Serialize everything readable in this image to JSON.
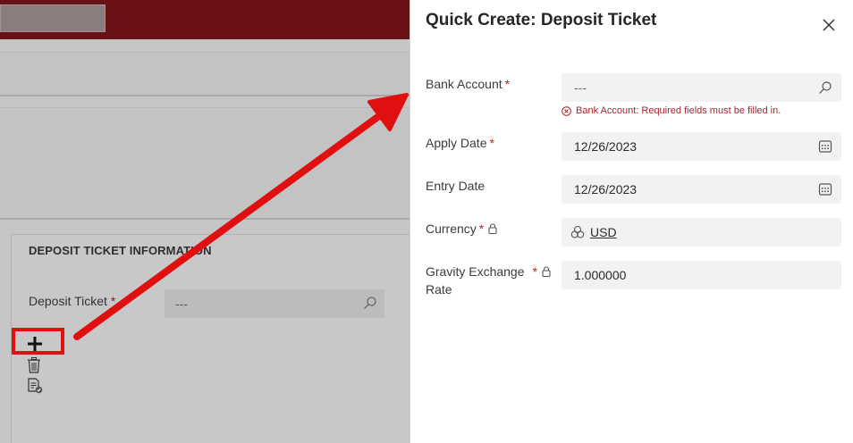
{
  "background": {
    "section_title": "DEPOSIT TICKET INFORMATION",
    "deposit_ticket_label": "Deposit Ticket",
    "required_marker": "*",
    "deposit_ticket_value": "---",
    "icons": [
      "search-icon",
      "add-icon",
      "trash-icon",
      "document-check-icon"
    ]
  },
  "panel": {
    "title": "Quick Create: Deposit Ticket",
    "fields": {
      "bank_account": {
        "label": "Bank Account",
        "required": "*",
        "placeholder": "---",
        "error": "Bank Account: Required fields must be filled in."
      },
      "apply_date": {
        "label": "Apply Date",
        "required": "*",
        "value": "12/26/2023"
      },
      "entry_date": {
        "label": "Entry Date",
        "value": "12/26/2023"
      },
      "currency": {
        "label": "Currency",
        "required": "*",
        "value": "USD"
      },
      "exchange_rate": {
        "label_line1": "Gravity Exchange",
        "label_line2": "Rate",
        "required": "*",
        "value": "1.000000"
      }
    }
  },
  "colors": {
    "header": "#6a1017",
    "required": "#a4262c",
    "annotation": "#e01010",
    "field_bg": "#f2f2f2"
  }
}
